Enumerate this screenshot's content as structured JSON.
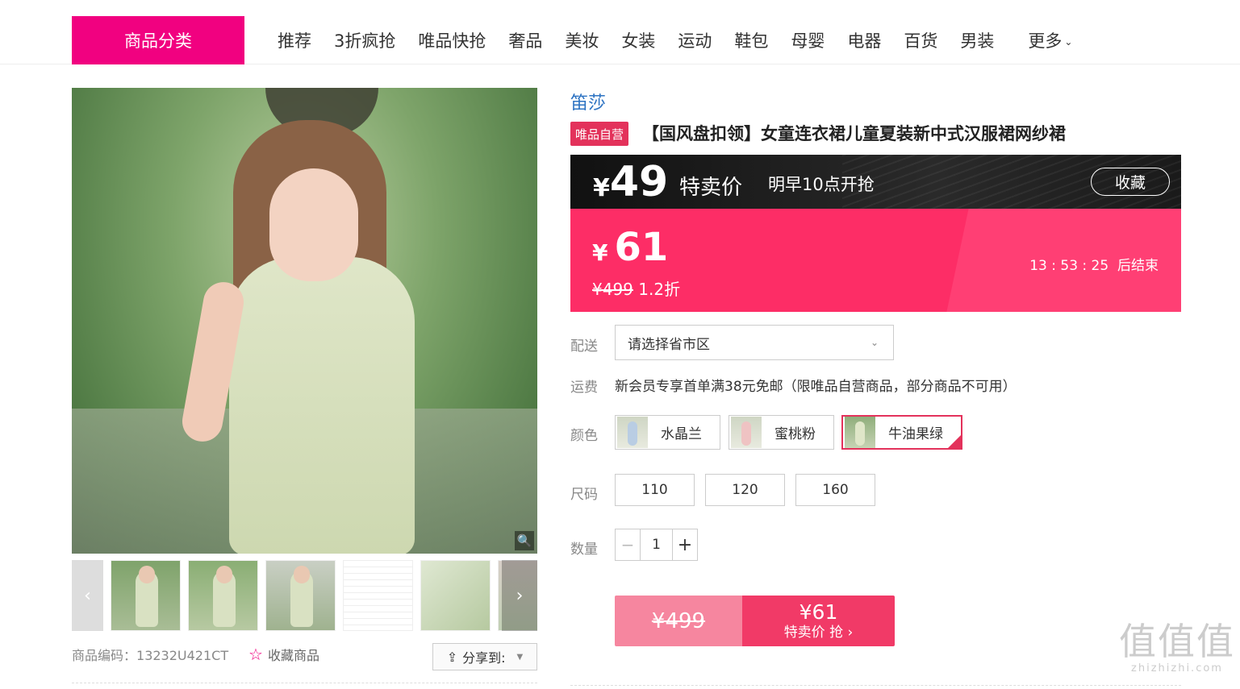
{
  "nav": {
    "category_button": "商品分类",
    "items": [
      "推荐",
      "3折疯抢",
      "唯品快抢",
      "奢品",
      "美妆",
      "女装",
      "运动",
      "鞋包",
      "母婴",
      "电器",
      "百货",
      "男装"
    ],
    "more": "更多"
  },
  "product": {
    "brand": "笛莎",
    "self_tag": "唯品自营",
    "title": "【国风盘扣领】女童连衣裙儿童夏装新中式汉服裙网纱裙",
    "sku_label": "商品编码：",
    "sku": "13232U421CT",
    "favorite_label": "收藏商品",
    "share_label": "分享到:"
  },
  "promo": {
    "currency": "¥",
    "flash_price": "49",
    "flash_label": "特卖价",
    "flash_time": "明早10点开抢",
    "favorite_button": "收藏",
    "price": "61",
    "original_price": "¥499",
    "discount": "1.2折",
    "countdown": "13 : 53 : 25",
    "countdown_suffix": "后结束"
  },
  "options": {
    "delivery_label": "配送",
    "region_placeholder": "请选择省市区",
    "freight_label": "运费",
    "freight_text": "新会员专享首单满38元免邮（限唯品自营商品，部分商品不可用）",
    "color_label": "颜色",
    "colors": [
      "水晶兰",
      "蜜桃粉",
      "牛油果绿"
    ],
    "selected_color": "牛油果绿",
    "size_label": "尺码",
    "sizes": [
      "110",
      "120",
      "160"
    ],
    "qty_label": "数量",
    "quantity": "1"
  },
  "buy": {
    "original": "¥499",
    "price": "¥61",
    "cta": "特卖价 抢"
  },
  "watermark": {
    "big": "值值值",
    "small": "zhizhizhi.com"
  },
  "colors": {
    "accent_pink": "#f10180",
    "promo_red": "#fd2d66",
    "brand_blue": "#2d73c2"
  }
}
